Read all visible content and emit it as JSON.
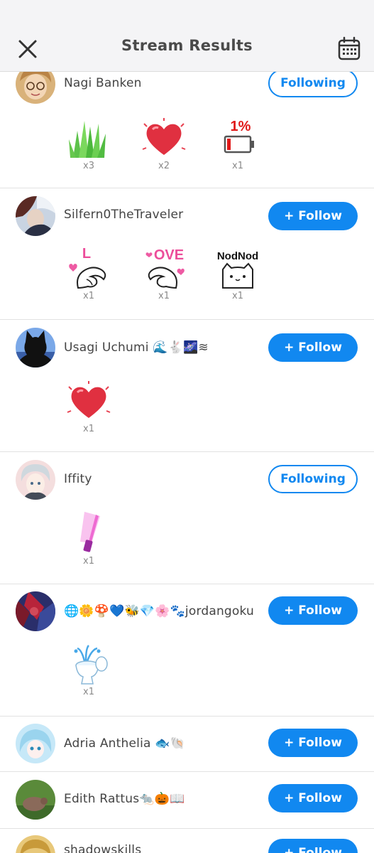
{
  "header": {
    "title": "Stream Results"
  },
  "rows": [
    {
      "username": "Nagi Banken",
      "button": "Following",
      "gifts": [
        {
          "icon": "grass-icon",
          "count": "x3"
        },
        {
          "icon": "heart-icon",
          "count": "x2"
        },
        {
          "icon": "low-battery-icon",
          "label": "1%",
          "count": "x1"
        }
      ]
    },
    {
      "username": "Silfern0TheTraveler",
      "button": "+ Follow",
      "gifts": [
        {
          "icon": "hand-heart-left-icon",
          "label": "L",
          "count": "x1"
        },
        {
          "icon": "hand-heart-right-icon",
          "label": "OVE",
          "count": "x1"
        },
        {
          "icon": "nodding-cat-icon",
          "label": "NodNod",
          "count": "x1"
        }
      ]
    },
    {
      "username": "Usagi Uchumi 🌊🐇🌌≋",
      "button": "+ Follow",
      "gifts": [
        {
          "icon": "heart-icon",
          "count": "x1"
        }
      ]
    },
    {
      "username": "Iffity",
      "button": "Following",
      "gifts": [
        {
          "icon": "glow-stick-icon",
          "count": "x1"
        }
      ]
    },
    {
      "username": "🌐🌼🍄💙🐝💎🌸🐾jordangoku",
      "button": "+ Follow",
      "gifts": [
        {
          "icon": "fountain-toilet-icon",
          "count": "x1"
        }
      ]
    },
    {
      "username": "Adria Anthelia 🐟🐚",
      "button": "+ Follow",
      "gifts": []
    },
    {
      "username": "Edith Rattus🐀🎃📖",
      "button": "+ Follow",
      "gifts": []
    },
    {
      "username": "shadowskills",
      "button": "+ Follow",
      "gifts": []
    }
  ]
}
